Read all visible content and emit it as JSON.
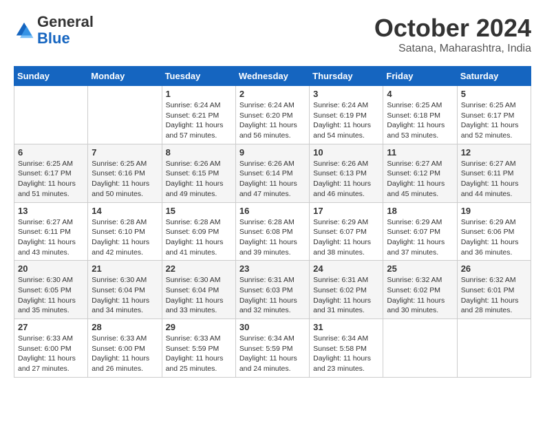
{
  "logo": {
    "general": "General",
    "blue": "Blue"
  },
  "title": "October 2024",
  "location": "Satana, Maharashtra, India",
  "days_of_week": [
    "Sunday",
    "Monday",
    "Tuesday",
    "Wednesday",
    "Thursday",
    "Friday",
    "Saturday"
  ],
  "weeks": [
    [
      {
        "day": "",
        "info": ""
      },
      {
        "day": "",
        "info": ""
      },
      {
        "day": "1",
        "info": "Sunrise: 6:24 AM\nSunset: 6:21 PM\nDaylight: 11 hours and 57 minutes."
      },
      {
        "day": "2",
        "info": "Sunrise: 6:24 AM\nSunset: 6:20 PM\nDaylight: 11 hours and 56 minutes."
      },
      {
        "day": "3",
        "info": "Sunrise: 6:24 AM\nSunset: 6:19 PM\nDaylight: 11 hours and 54 minutes."
      },
      {
        "day": "4",
        "info": "Sunrise: 6:25 AM\nSunset: 6:18 PM\nDaylight: 11 hours and 53 minutes."
      },
      {
        "day": "5",
        "info": "Sunrise: 6:25 AM\nSunset: 6:17 PM\nDaylight: 11 hours and 52 minutes."
      }
    ],
    [
      {
        "day": "6",
        "info": "Sunrise: 6:25 AM\nSunset: 6:17 PM\nDaylight: 11 hours and 51 minutes."
      },
      {
        "day": "7",
        "info": "Sunrise: 6:25 AM\nSunset: 6:16 PM\nDaylight: 11 hours and 50 minutes."
      },
      {
        "day": "8",
        "info": "Sunrise: 6:26 AM\nSunset: 6:15 PM\nDaylight: 11 hours and 49 minutes."
      },
      {
        "day": "9",
        "info": "Sunrise: 6:26 AM\nSunset: 6:14 PM\nDaylight: 11 hours and 47 minutes."
      },
      {
        "day": "10",
        "info": "Sunrise: 6:26 AM\nSunset: 6:13 PM\nDaylight: 11 hours and 46 minutes."
      },
      {
        "day": "11",
        "info": "Sunrise: 6:27 AM\nSunset: 6:12 PM\nDaylight: 11 hours and 45 minutes."
      },
      {
        "day": "12",
        "info": "Sunrise: 6:27 AM\nSunset: 6:11 PM\nDaylight: 11 hours and 44 minutes."
      }
    ],
    [
      {
        "day": "13",
        "info": "Sunrise: 6:27 AM\nSunset: 6:11 PM\nDaylight: 11 hours and 43 minutes."
      },
      {
        "day": "14",
        "info": "Sunrise: 6:28 AM\nSunset: 6:10 PM\nDaylight: 11 hours and 42 minutes."
      },
      {
        "day": "15",
        "info": "Sunrise: 6:28 AM\nSunset: 6:09 PM\nDaylight: 11 hours and 41 minutes."
      },
      {
        "day": "16",
        "info": "Sunrise: 6:28 AM\nSunset: 6:08 PM\nDaylight: 11 hours and 39 minutes."
      },
      {
        "day": "17",
        "info": "Sunrise: 6:29 AM\nSunset: 6:07 PM\nDaylight: 11 hours and 38 minutes."
      },
      {
        "day": "18",
        "info": "Sunrise: 6:29 AM\nSunset: 6:07 PM\nDaylight: 11 hours and 37 minutes."
      },
      {
        "day": "19",
        "info": "Sunrise: 6:29 AM\nSunset: 6:06 PM\nDaylight: 11 hours and 36 minutes."
      }
    ],
    [
      {
        "day": "20",
        "info": "Sunrise: 6:30 AM\nSunset: 6:05 PM\nDaylight: 11 hours and 35 minutes."
      },
      {
        "day": "21",
        "info": "Sunrise: 6:30 AM\nSunset: 6:04 PM\nDaylight: 11 hours and 34 minutes."
      },
      {
        "day": "22",
        "info": "Sunrise: 6:30 AM\nSunset: 6:04 PM\nDaylight: 11 hours and 33 minutes."
      },
      {
        "day": "23",
        "info": "Sunrise: 6:31 AM\nSunset: 6:03 PM\nDaylight: 11 hours and 32 minutes."
      },
      {
        "day": "24",
        "info": "Sunrise: 6:31 AM\nSunset: 6:02 PM\nDaylight: 11 hours and 31 minutes."
      },
      {
        "day": "25",
        "info": "Sunrise: 6:32 AM\nSunset: 6:02 PM\nDaylight: 11 hours and 30 minutes."
      },
      {
        "day": "26",
        "info": "Sunrise: 6:32 AM\nSunset: 6:01 PM\nDaylight: 11 hours and 28 minutes."
      }
    ],
    [
      {
        "day": "27",
        "info": "Sunrise: 6:33 AM\nSunset: 6:00 PM\nDaylight: 11 hours and 27 minutes."
      },
      {
        "day": "28",
        "info": "Sunrise: 6:33 AM\nSunset: 6:00 PM\nDaylight: 11 hours and 26 minutes."
      },
      {
        "day": "29",
        "info": "Sunrise: 6:33 AM\nSunset: 5:59 PM\nDaylight: 11 hours and 25 minutes."
      },
      {
        "day": "30",
        "info": "Sunrise: 6:34 AM\nSunset: 5:59 PM\nDaylight: 11 hours and 24 minutes."
      },
      {
        "day": "31",
        "info": "Sunrise: 6:34 AM\nSunset: 5:58 PM\nDaylight: 11 hours and 23 minutes."
      },
      {
        "day": "",
        "info": ""
      },
      {
        "day": "",
        "info": ""
      }
    ]
  ]
}
